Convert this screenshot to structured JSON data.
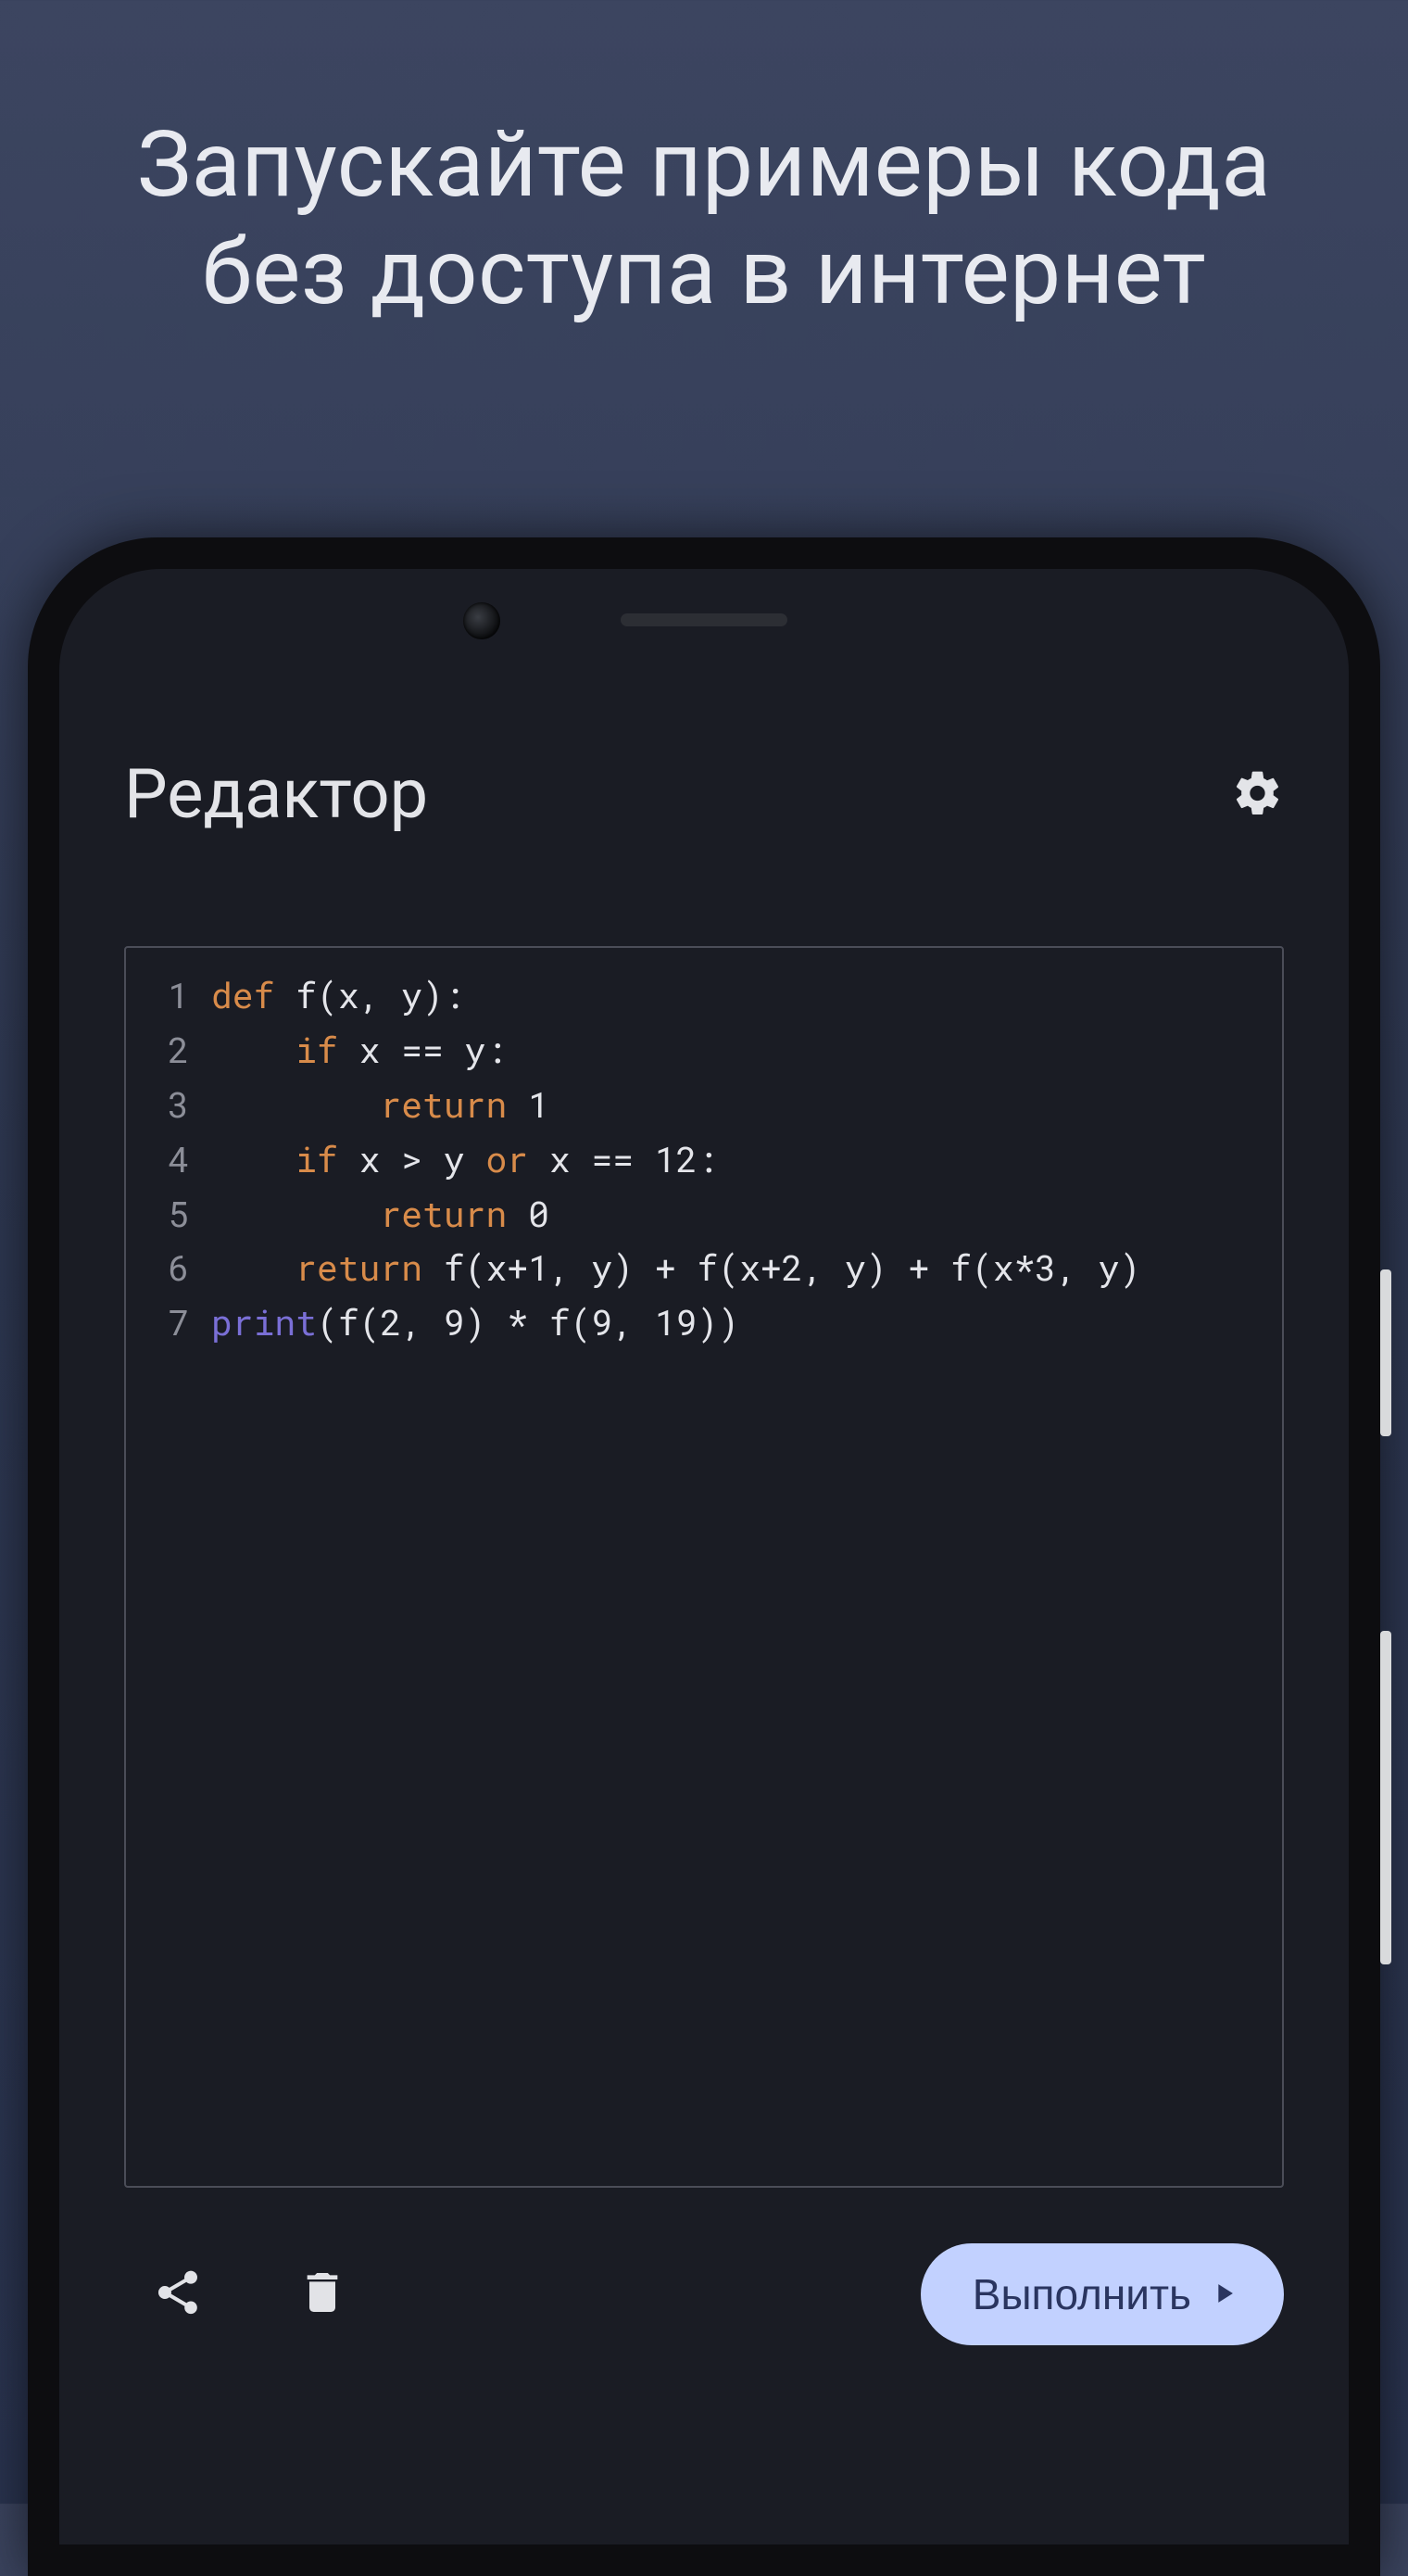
{
  "headline_line1": "Запускайте примеры кода",
  "headline_line2": "без доступа в интернет",
  "app": {
    "title": "Редактор"
  },
  "code": {
    "lines": [
      {
        "num": "1",
        "tokens": [
          [
            "kw",
            "def"
          ],
          [
            "op",
            " f(x, y):"
          ]
        ]
      },
      {
        "num": "2",
        "tokens": [
          [
            "op",
            "    "
          ],
          [
            "kw",
            "if"
          ],
          [
            "op",
            " x == y:"
          ]
        ]
      },
      {
        "num": "3",
        "tokens": [
          [
            "op",
            "        "
          ],
          [
            "kw",
            "return"
          ],
          [
            "op",
            " 1"
          ]
        ]
      },
      {
        "num": "4",
        "tokens": [
          [
            "op",
            "    "
          ],
          [
            "kw",
            "if"
          ],
          [
            "op",
            " x > y "
          ],
          [
            "kw",
            "or"
          ],
          [
            "op",
            " x == 12:"
          ]
        ]
      },
      {
        "num": "5",
        "tokens": [
          [
            "op",
            "        "
          ],
          [
            "kw",
            "return"
          ],
          [
            "op",
            " 0"
          ]
        ]
      },
      {
        "num": "6",
        "tokens": [
          [
            "op",
            "    "
          ],
          [
            "kw",
            "return"
          ],
          [
            "op",
            " f(x+1, y) + f(x+2, y) + f(x*3, y)"
          ]
        ]
      },
      {
        "num": "7",
        "tokens": [
          [
            "fn",
            "print"
          ],
          [
            "op",
            "(f(2, 9) * f(9, 19))"
          ]
        ]
      }
    ]
  },
  "toolbar": {
    "run_label": "Выполнить"
  }
}
